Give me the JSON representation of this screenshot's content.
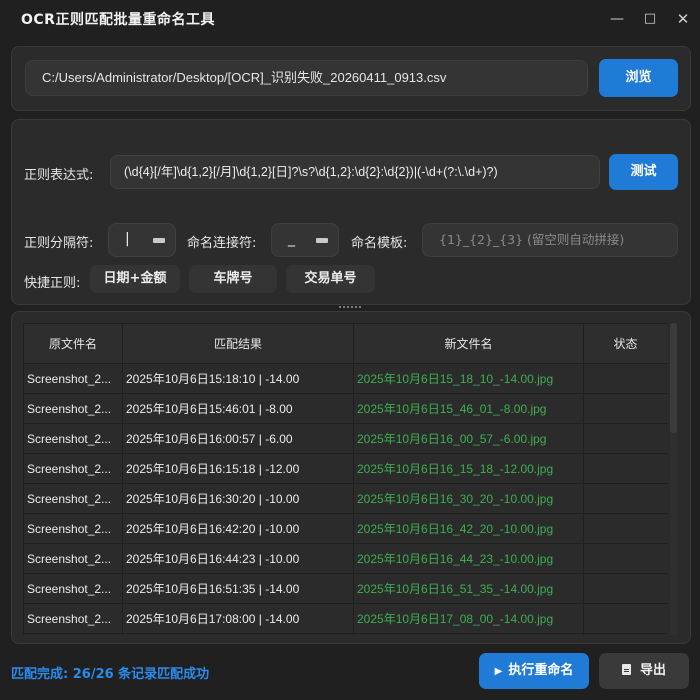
{
  "window": {
    "title": "OCR正则匹配批量重命名工具",
    "controls": {
      "minimize": "—",
      "maximize": "□",
      "close": "✕"
    }
  },
  "file": {
    "path": "C:/Users/Administrator/Desktop/[OCR]_识别失败_20260411_0913.csv",
    "browse_label": "浏览"
  },
  "regex": {
    "label": "正则表达式:",
    "value": "(\\d{4}[/年]\\d{1,2}[/月]\\d{1,2}[日]?\\s?\\d{1,2}:\\d{2}:\\d{2})|(-\\d+(?:\\.\\d+)?)",
    "test_label": "测试"
  },
  "options": {
    "separator_label": "正则分隔符:",
    "separator_value": "|",
    "joiner_label": "命名连接符:",
    "joiner_value": "_",
    "template_label": "命名模板:",
    "template_placeholder": "{1}_{2}_{3} (留空则自动拼接)"
  },
  "quick": {
    "label": "快捷正则:",
    "chips": [
      "日期+金额",
      "车牌号",
      "交易单号"
    ]
  },
  "table": {
    "headers": [
      "原文件名",
      "匹配结果",
      "新文件名",
      "状态"
    ],
    "rows": [
      {
        "original": "Screenshot_2...",
        "match": "2025年10月6日15:18:10 | -14.00",
        "newname": "2025年10月6日15_18_10_-14.00.jpg",
        "status": ""
      },
      {
        "original": "Screenshot_2...",
        "match": "2025年10月6日15:46:01 | -8.00",
        "newname": "2025年10月6日15_46_01_-8.00.jpg",
        "status": ""
      },
      {
        "original": "Screenshot_2...",
        "match": "2025年10月6日16:00:57 | -6.00",
        "newname": "2025年10月6日16_00_57_-6.00.jpg",
        "status": ""
      },
      {
        "original": "Screenshot_2...",
        "match": "2025年10月6日16:15:18 | -12.00",
        "newname": "2025年10月6日16_15_18_-12.00.jpg",
        "status": ""
      },
      {
        "original": "Screenshot_2...",
        "match": "2025年10月6日16:30:20 | -10.00",
        "newname": "2025年10月6日16_30_20_-10.00.jpg",
        "status": ""
      },
      {
        "original": "Screenshot_2...",
        "match": "2025年10月6日16:42:20 | -10.00",
        "newname": "2025年10月6日16_42_20_-10.00.jpg",
        "status": ""
      },
      {
        "original": "Screenshot_2...",
        "match": "2025年10月6日16:44:23 | -10.00",
        "newname": "2025年10月6日16_44_23_-10.00.jpg",
        "status": ""
      },
      {
        "original": "Screenshot_2...",
        "match": "2025年10月6日16:51:35 | -14.00",
        "newname": "2025年10月6日16_51_35_-14.00.jpg",
        "status": ""
      },
      {
        "original": "Screenshot_2...",
        "match": "2025年10月6日17:08:00 | -14.00",
        "newname": "2025年10月6日17_08_00_-14.00.jpg",
        "status": ""
      },
      {
        "original": "",
        "match": "",
        "newname": "",
        "status": ""
      }
    ]
  },
  "footer": {
    "status": "匹配完成: 26/26 条记录匹配成功",
    "run_label": "执行重命名",
    "export_label": "导出"
  },
  "colors": {
    "accent": "#1f7bd6",
    "status_text": "#2a8bec",
    "new_filename": "#3fae52"
  }
}
